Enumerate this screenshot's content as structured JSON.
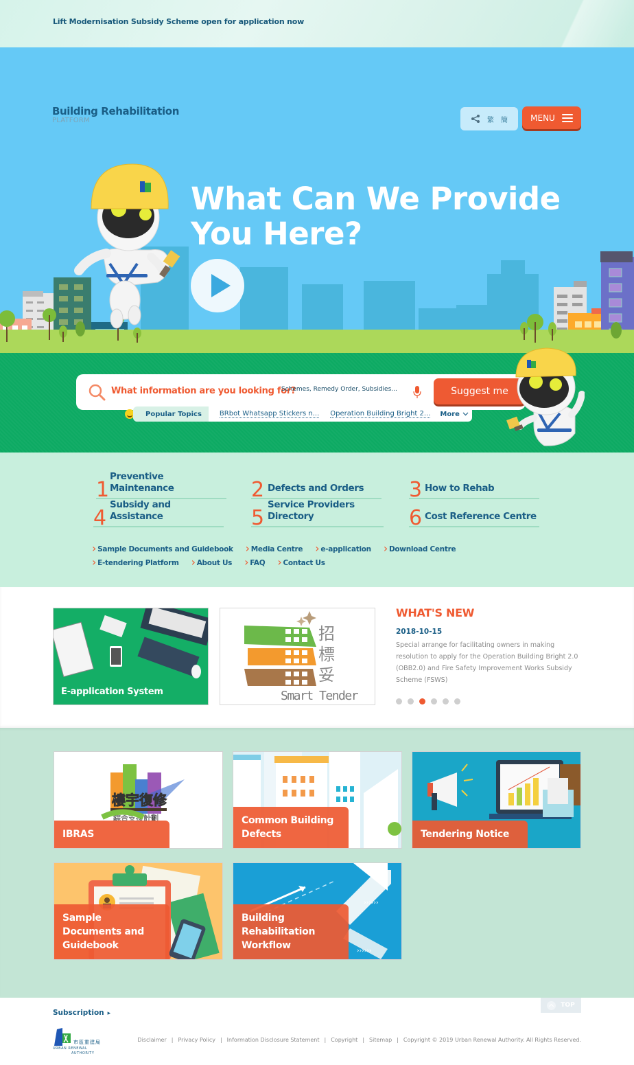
{
  "announcement": {
    "text": "Lift Modernisation Subsidy Scheme open for application now"
  },
  "header": {
    "logo_line1": "Building Rehabilitation",
    "logo_line2": "PLATFORM",
    "lang_trad": "繁",
    "lang_simp": "簡",
    "menu_label": "MENU"
  },
  "hero": {
    "title": "What Can We Provide You Here?",
    "play_icon": "play-icon"
  },
  "search": {
    "question": "What information are you looking for?",
    "placeholder": "Schemes, Remedy Order, Subsidies...",
    "value": "",
    "suggest_label": "Suggest me",
    "popular_label": "Popular Topics",
    "topics": [
      "BRbot Whatsapp Stickers n...",
      "Operation Building Bright 2..."
    ],
    "more_label": "More"
  },
  "categories": [
    {
      "num": "1",
      "label": "Preventive Maintenance"
    },
    {
      "num": "2",
      "label": "Defects and Orders"
    },
    {
      "num": "3",
      "label": "How to Rehab"
    },
    {
      "num": "4",
      "label": "Subsidy and Assistance"
    },
    {
      "num": "5",
      "label": "Service Providers Directory"
    },
    {
      "num": "6",
      "label": "Cost Reference Centre"
    }
  ],
  "quick_links": {
    "row1": [
      "Sample Documents and Guidebook",
      "Media Centre",
      "e-application",
      "Download Centre"
    ],
    "row2": [
      "E-tendering Platform",
      "About Us",
      "FAQ",
      "Contact Us"
    ]
  },
  "features": {
    "eapp_label": "E-application System",
    "smart_tender_cjk": "招標妥",
    "smart_tender_en": "Smart Tender"
  },
  "whats_new": {
    "heading": "WHAT'S NEW",
    "date": "2018-10-15",
    "text": "Special arrange for facilitating owners in making resolution to apply for the Operation Building Bright 2.0 (OBB2.0) and Fire Safety Improvement Works Subsidy Scheme (FSWS)",
    "slides": 6,
    "active_slide": 3
  },
  "tiles": [
    {
      "label": "IBRAS",
      "image_text": "樓宇復修",
      "image_sub": "綜合支援計劃"
    },
    {
      "label": "Common Building Defects"
    },
    {
      "label": "Tendering Notice"
    },
    {
      "label": "Sample Documents and Guidebook"
    },
    {
      "label": "Building Rehabilitation Workflow"
    }
  ],
  "footer": {
    "subscription": "Subscription",
    "top_label": "TOP",
    "ura_cn": "市區重建局",
    "ura_en1": "URBAN RENEWAL",
    "ura_en2": "AUTHORITY",
    "links": [
      "Disclaimer",
      "Privacy Policy",
      "Information Disclosure Statement",
      "Copyright",
      "Sitemap"
    ],
    "copyright": "Copyright © 2019 Urban Renewal Authority. All Rights Reserved."
  },
  "colors": {
    "accent_orange": "#ef5a31",
    "sky_blue": "#65c9f6",
    "brand_green": "#0daa63",
    "mint": "#c8efdd",
    "navy_text": "#1a5e86"
  }
}
